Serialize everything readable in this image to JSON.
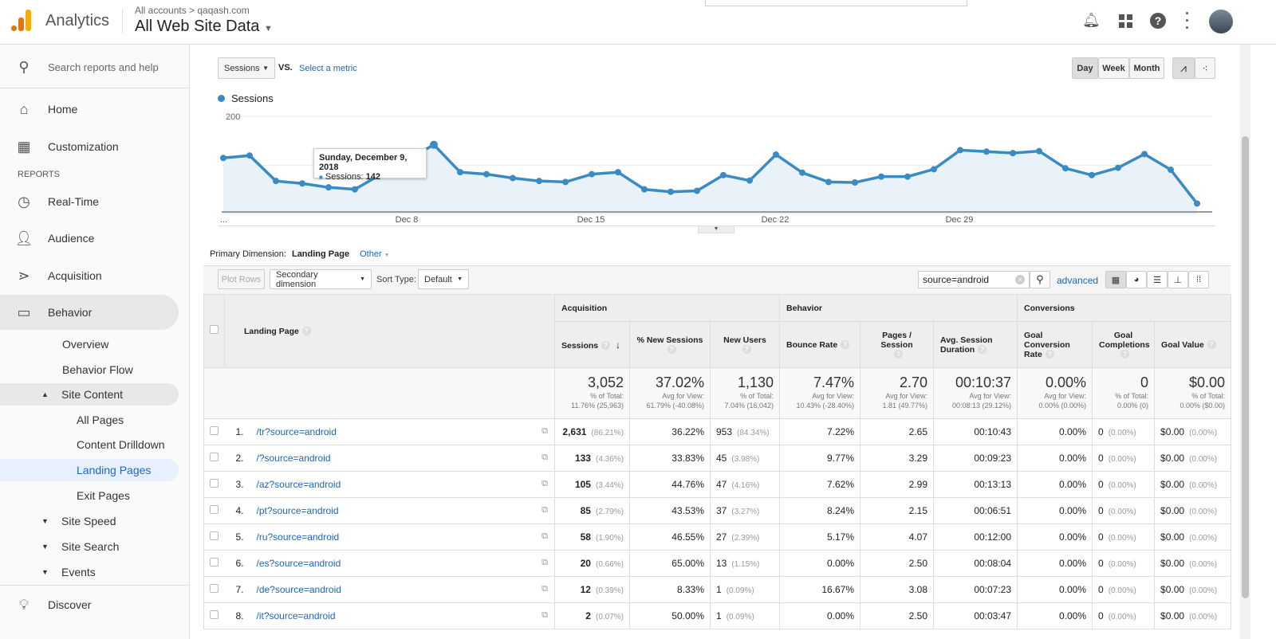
{
  "header": {
    "app": "Analytics",
    "breadcrumb": "All accounts > qaqash.com",
    "property": "All Web Site Data"
  },
  "sidebar": {
    "search_placeholder": "Search reports and help",
    "home": "Home",
    "customization": "Customization",
    "reports_label": "REPORTS",
    "realtime": "Real-Time",
    "audience": "Audience",
    "acquisition": "Acquisition",
    "behavior": "Behavior",
    "overview": "Overview",
    "behavior_flow": "Behavior Flow",
    "site_content": "Site Content",
    "all_pages": "All Pages",
    "content_drilldown": "Content Drilldown",
    "landing_pages": "Landing Pages",
    "exit_pages": "Exit Pages",
    "site_speed": "Site Speed",
    "site_search": "Site Search",
    "events": "Events",
    "discover": "Discover"
  },
  "controls": {
    "metric": "Sessions",
    "vs": "VS.",
    "select_metric": "Select a metric",
    "day": "Day",
    "week": "Week",
    "month": "Month"
  },
  "chart_data": {
    "type": "line",
    "series_name": "Sessions",
    "ylim": [
      0,
      200
    ],
    "yticks": [
      "200",
      "100"
    ],
    "xtick_labels": [
      "...",
      "Dec 8",
      "Dec 15",
      "Dec 22",
      "Dec 29"
    ],
    "x": [
      "Dec 1",
      "Dec 2",
      "Dec 3",
      "Dec 4",
      "Dec 5",
      "Dec 6",
      "Dec 7",
      "Dec 8",
      "Dec 9",
      "Dec 10",
      "Dec 11",
      "Dec 12",
      "Dec 13",
      "Dec 14",
      "Dec 15",
      "Dec 16",
      "Dec 17",
      "Dec 18",
      "Dec 19",
      "Dec 20",
      "Dec 21",
      "Dec 22",
      "Dec 23",
      "Dec 24",
      "Dec 25",
      "Dec 26",
      "Dec 27",
      "Dec 28",
      "Dec 29",
      "Dec 30",
      "Dec 31",
      "Jan 1",
      "Jan 2",
      "Jan 3",
      "Jan 4",
      "Jan 5",
      "Jan 6",
      "Jan 7"
    ],
    "values": [
      115,
      120,
      68,
      63,
      55,
      51,
      82,
      112,
      142,
      86,
      82,
      74,
      68,
      66,
      82,
      86,
      51,
      46,
      48,
      80,
      69,
      122,
      85,
      66,
      65,
      77,
      77,
      92,
      131,
      128,
      125,
      129,
      94,
      80,
      95,
      123,
      91,
      22
    ],
    "color": "#3a8ac4",
    "tooltip": {
      "title": "Sunday, December 9, 2018",
      "label": "Sessions:",
      "value": "142"
    }
  },
  "dimension": {
    "label": "Primary Dimension:",
    "value": "Landing Page",
    "other": "Other"
  },
  "toolbar": {
    "plot_rows": "Plot Rows",
    "secondary": "Secondary dimension",
    "sort_label": "Sort Type:",
    "sort_value": "Default",
    "search_value": "source=android",
    "advanced": "advanced"
  },
  "table": {
    "groups": [
      "Acquisition",
      "Behavior",
      "Conversions"
    ],
    "headers": [
      "Landing Page",
      "Sessions",
      "% New Sessions",
      "New Users",
      "Bounce Rate",
      "Pages / Session",
      "Avg. Session Duration",
      "Goal Conversion Rate",
      "Goal Completions",
      "Goal Value"
    ],
    "totals": [
      {
        "v": "3,052",
        "s1": "% of Total:",
        "s2": "11.76% (25,963)"
      },
      {
        "v": "37.02%",
        "s1": "Avg for View:",
        "s2": "61.79% (-40.08%)"
      },
      {
        "v": "1,130",
        "s1": "% of Total:",
        "s2": "7.04% (16,042)"
      },
      {
        "v": "7.47%",
        "s1": "Avg for View:",
        "s2": "10.43% (-28.40%)"
      },
      {
        "v": "2.70",
        "s1": "Avg for View:",
        "s2": "1.81 (49.77%)"
      },
      {
        "v": "00:10:37",
        "s1": "Avg for View:",
        "s2": "00:08:13 (29.12%)"
      },
      {
        "v": "0.00%",
        "s1": "Avg for View:",
        "s2": "0.00% (0.00%)"
      },
      {
        "v": "0",
        "s1": "% of Total:",
        "s2": "0.00% (0)"
      },
      {
        "v": "$0.00",
        "s1": "% of Total:",
        "s2": "0.00% ($0.00)"
      }
    ],
    "rows": [
      {
        "n": "1.",
        "page": "/tr?source=android",
        "s": "2,631",
        "sp": "(86.21%)",
        "ns": "36.22%",
        "nu": "953",
        "nup": "(84.34%)",
        "br": "7.22%",
        "ps": "2.65",
        "d": "00:10:43",
        "gcr": "0.00%",
        "gc": "0",
        "gcp": "(0.00%)",
        "gv": "$0.00",
        "gvp": "(0.00%)"
      },
      {
        "n": "2.",
        "page": "/?source=android",
        "s": "133",
        "sp": "(4.36%)",
        "ns": "33.83%",
        "nu": "45",
        "nup": "(3.98%)",
        "br": "9.77%",
        "ps": "3.29",
        "d": "00:09:23",
        "gcr": "0.00%",
        "gc": "0",
        "gcp": "(0.00%)",
        "gv": "$0.00",
        "gvp": "(0.00%)"
      },
      {
        "n": "3.",
        "page": "/az?source=android",
        "s": "105",
        "sp": "(3.44%)",
        "ns": "44.76%",
        "nu": "47",
        "nup": "(4.16%)",
        "br": "7.62%",
        "ps": "2.99",
        "d": "00:13:13",
        "gcr": "0.00%",
        "gc": "0",
        "gcp": "(0.00%)",
        "gv": "$0.00",
        "gvp": "(0.00%)"
      },
      {
        "n": "4.",
        "page": "/pt?source=android",
        "s": "85",
        "sp": "(2.79%)",
        "ns": "43.53%",
        "nu": "37",
        "nup": "(3.27%)",
        "br": "8.24%",
        "ps": "2.15",
        "d": "00:06:51",
        "gcr": "0.00%",
        "gc": "0",
        "gcp": "(0.00%)",
        "gv": "$0.00",
        "gvp": "(0.00%)"
      },
      {
        "n": "5.",
        "page": "/ru?source=android",
        "s": "58",
        "sp": "(1.90%)",
        "ns": "46.55%",
        "nu": "27",
        "nup": "(2.39%)",
        "br": "5.17%",
        "ps": "4.07",
        "d": "00:12:00",
        "gcr": "0.00%",
        "gc": "0",
        "gcp": "(0.00%)",
        "gv": "$0.00",
        "gvp": "(0.00%)"
      },
      {
        "n": "6.",
        "page": "/es?source=android",
        "s": "20",
        "sp": "(0.66%)",
        "ns": "65.00%",
        "nu": "13",
        "nup": "(1.15%)",
        "br": "0.00%",
        "ps": "2.50",
        "d": "00:08:04",
        "gcr": "0.00%",
        "gc": "0",
        "gcp": "(0.00%)",
        "gv": "$0.00",
        "gvp": "(0.00%)"
      },
      {
        "n": "7.",
        "page": "/de?source=android",
        "s": "12",
        "sp": "(0.39%)",
        "ns": "8.33%",
        "nu": "1",
        "nup": "(0.09%)",
        "br": "16.67%",
        "ps": "3.08",
        "d": "00:07:23",
        "gcr": "0.00%",
        "gc": "0",
        "gcp": "(0.00%)",
        "gv": "$0.00",
        "gvp": "(0.00%)"
      },
      {
        "n": "8.",
        "page": "/it?source=android",
        "s": "2",
        "sp": "(0.07%)",
        "ns": "50.00%",
        "nu": "1",
        "nup": "(0.09%)",
        "br": "0.00%",
        "ps": "2.50",
        "d": "00:03:47",
        "gcr": "0.00%",
        "gc": "0",
        "gcp": "(0.00%)",
        "gv": "$0.00",
        "gvp": "(0.00%)"
      }
    ]
  }
}
